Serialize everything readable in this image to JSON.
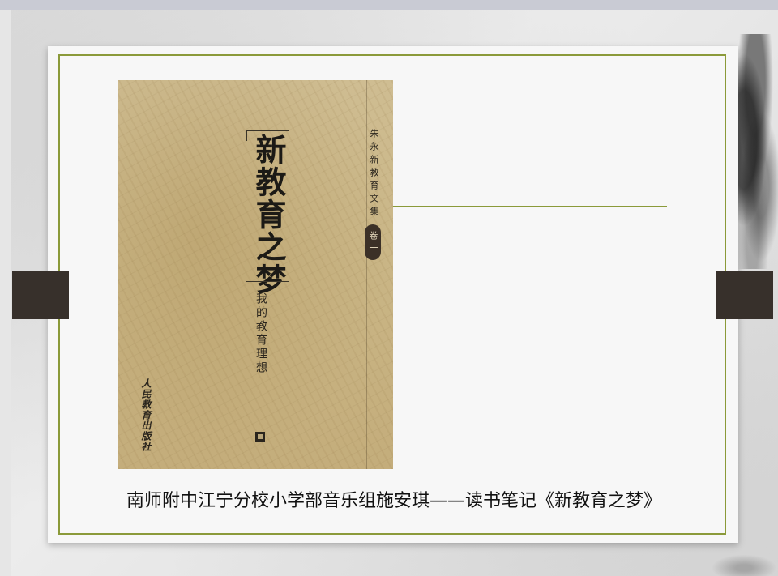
{
  "colors": {
    "frame_border": "#8b9a3a",
    "tab_fill": "#37302b",
    "cover_paper": "#c9b585",
    "caption_text": "#111111"
  },
  "book_cover": {
    "title": "新教育之梦",
    "subtitle": "我的教育理想",
    "series": "朱永新教育文集",
    "volume": "卷一",
    "publisher": "人民教育出版社",
    "publisher_logo_icon": "publisher-logo-icon"
  },
  "caption": "南师附中江宁分校小学部音乐组施安琪——读书笔记《新教育之梦》"
}
